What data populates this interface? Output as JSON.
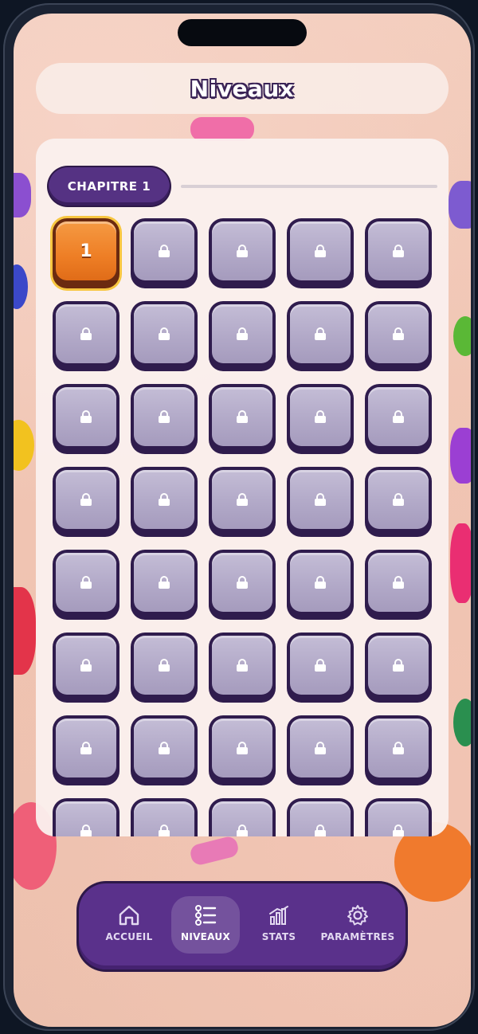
{
  "header": {
    "title": "Niveaux"
  },
  "chapter": {
    "label": "CHAPITRE 1"
  },
  "levels": {
    "unlocked_label": "1",
    "count": 40
  },
  "nav": {
    "items": [
      {
        "label": "ACCUEIL",
        "icon": "home-icon"
      },
      {
        "label": "NIVEAUX",
        "icon": "list-icon",
        "active": true
      },
      {
        "label": "STATS",
        "icon": "bar-chart-icon"
      },
      {
        "label": "PARAMÈTRES",
        "icon": "gear-icon"
      }
    ]
  },
  "colors": {
    "accent": "#553283",
    "unlocked_level": "#ee7e25",
    "locked_level": "#b2a9c8"
  }
}
